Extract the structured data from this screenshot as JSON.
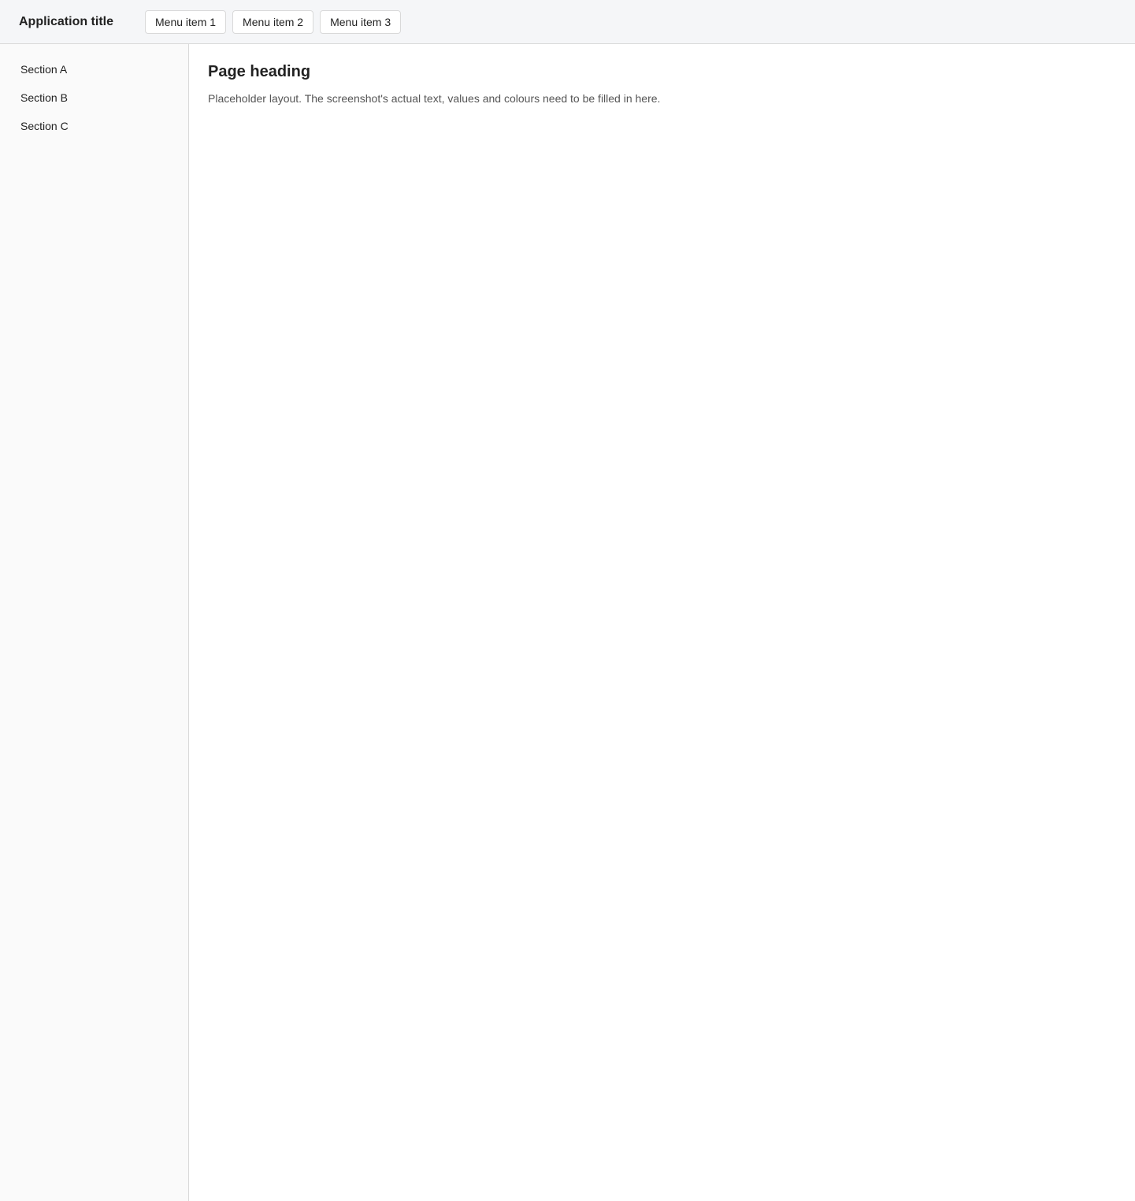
{
  "window": {
    "title": "Application title"
  },
  "nav": {
    "items": [
      {
        "label": "Menu item 1"
      },
      {
        "label": "Menu item 2"
      },
      {
        "label": "Menu item 3"
      }
    ]
  },
  "sidebar": {
    "items": [
      {
        "label": "Section A"
      },
      {
        "label": "Section B"
      },
      {
        "label": "Section C"
      }
    ]
  },
  "main": {
    "heading": "Page heading",
    "notice": "Placeholder layout. The screenshot's actual text, values and colours need to be filled in here."
  },
  "colors": {
    "background": "#ffffff",
    "panel": "#f5f6f8",
    "border": "#d9d9d9"
  }
}
